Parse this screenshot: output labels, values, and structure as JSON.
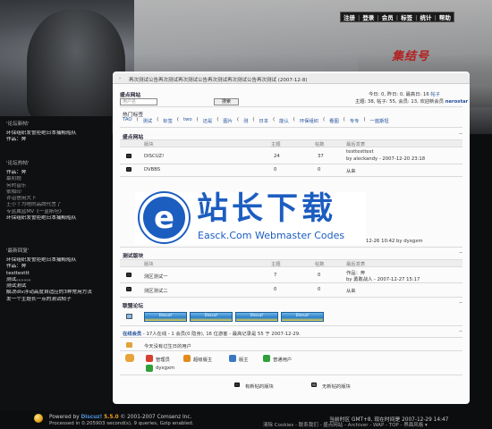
{
  "topnav": [
    "注册",
    "登录",
    "会员",
    "标签",
    "统计",
    "帮助"
  ],
  "hero_logo": "集结号",
  "breadcrumb": "再次测试公告再次测试再次测试公告再次测试再次测试公告再次测试 (2007-12-8)",
  "header": {
    "section": "盛点网站",
    "search_placeholder": "用户名",
    "search_button": "搜索",
    "today": "今日: 0, 昨日: 0, 最高日: 16",
    "today_link": "帖子",
    "stats": "主题: 38, 帖子: 55, 会员: 13, 欢迎新会员",
    "new_member": "nerostar"
  },
  "hot_tags": {
    "title": "热门标签",
    "tags": [
      "TAO",
      "测试",
      "标签",
      "two",
      "还是",
      "图片",
      "测",
      "日本",
      "能认",
      "环保组织",
      "看图",
      "专专",
      "一蓝斯坦"
    ]
  },
  "forum_group_1": {
    "title": "盛点网站",
    "columns": [
      "版块",
      "主题",
      "帖数",
      "最后发表"
    ],
    "rows": [
      {
        "name": "DISCUZ!",
        "topics": "24",
        "posts": "37",
        "last_title": "testtesttest",
        "last_meta": "by aleckandy - 2007-12-20 23:18"
      },
      {
        "name": "DVBBS",
        "topics": "0",
        "posts": "0",
        "last_title": "从来",
        "last_meta": ""
      }
    ],
    "hidden_meta": "12-26 10:42 by dyxgxm"
  },
  "forum_group_2": {
    "title": "测试版块",
    "columns": [
      "版块",
      "主题",
      "帖数",
      "最后发表"
    ],
    "rows": [
      {
        "name": "测区测试一",
        "topics": "7",
        "posts": "0",
        "last_title": "作品：奔",
        "last_meta": "by 勇敢战人 - 2007-12-27 15:17"
      },
      {
        "name": "测区测试二",
        "topics": "0",
        "posts": "0",
        "last_title": "从来",
        "last_meta": ""
      }
    ]
  },
  "links": {
    "title": "联盟论坛",
    "banners": [
      "Discuz!",
      "Discuz!",
      "Discuz!",
      "Discuz!"
    ]
  },
  "online": {
    "title": "在线会员",
    "text": "- 17人在线 - 1 会员(0 隐身), 16 位游客 - 最高记录是 55 于 2007-12-29.",
    "birthday": "今天没有过生日的用户",
    "legend": [
      "管理员",
      "超级版主",
      "版主",
      "普通用户"
    ],
    "user": "dyxgxm"
  },
  "legend_bottom": [
    "有新帖的版块",
    "无新帖的版块"
  ],
  "sidebar": {
    "g1_title": "'论坛新帖'",
    "g1_items": [
      "环保组织发誓拒绝日本捕鲸船队",
      "作品：奔"
    ],
    "g2_title": "'论坛热帖'",
    "g2_items": [
      "作品：奔",
      "最初题",
      "何时音乐",
      "依相印",
      "许诏信用大下",
      "王小丫为啥的品牌代言了",
      "专蓝属蓝MV《一蓝斯坦》",
      "环保组织发誓拒绝日本捕鲸船队"
    ],
    "g3_title": "'最新回复'",
    "g3_items": [
      "环保组织发誓拒绝日本捕鲸船队",
      "作品：奔",
      "testtesttt",
      "测试。。。。。。",
      "测试测试",
      "解决div浮动高度自适应的3种常用方法",
      "发一个主题长一点的测试帖子"
    ]
  },
  "footer": {
    "powered_prefix": "Powered by",
    "product": "Discuz!",
    "version": "5.5.0",
    "copyright": "© 2001-2007 Comsenz Inc.",
    "processed": "Processed in 0.205903 second(s), 9 queries, Gzip enabled.",
    "timezone": "当前时区 GMT+8, 现在时间是 2007-12-29 14:47",
    "links": "清除 Cookies - 联系我们 - 盛点网站 - Archiver - WAP - TOP - 界面风格 ▾"
  },
  "watermark": {
    "cn": "站长下载",
    "en": "Easck.Com Webmaster Codes"
  },
  "colors": {
    "accent": "#1f4f9a",
    "watermark": "#1c5dc0",
    "logo_red": "#b32020"
  }
}
